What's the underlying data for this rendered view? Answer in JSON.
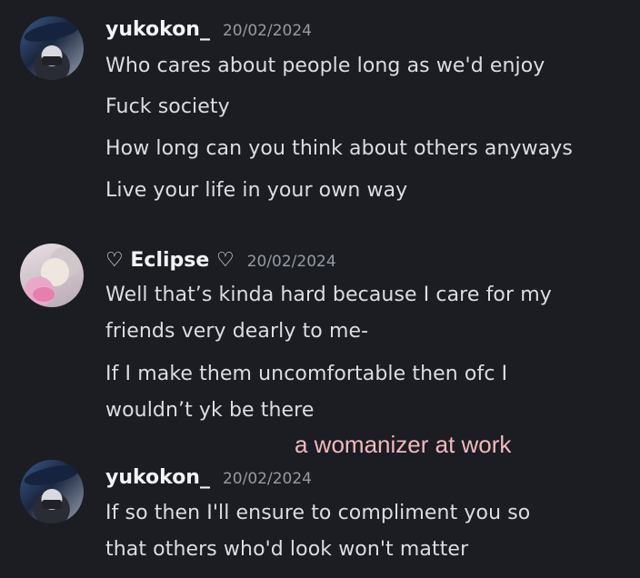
{
  "messages": [
    {
      "username": "yukokon_",
      "timestamp": "20/02/2024",
      "lines": [
        "Who cares about people long as we'd enjoy",
        "Fuck society",
        "How long can you think about others anyways",
        "Live your life in your own way"
      ]
    },
    {
      "username": "♡ Eclipse ♡",
      "timestamp": "20/02/2024",
      "lines": [
        "Well that’s kinda hard because I care for my",
        "friends very dearly to me-",
        "If I make them uncomfortable then ofc I",
        "wouldn’t yk be there"
      ]
    },
    {
      "username": "yukokon_",
      "timestamp": "20/02/2024",
      "lines": [
        "If so then I'll ensure to compliment you so",
        "that others who'd look won't matter"
      ]
    }
  ],
  "caption": "a womanizer at work",
  "colors": {
    "background": "#1c1d22",
    "caption": "#f2b8bf"
  }
}
